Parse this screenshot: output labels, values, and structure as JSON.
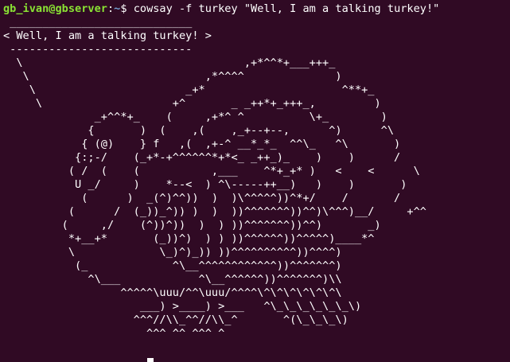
{
  "terminal": {
    "partial_line": "  ...",
    "prompt": {
      "user_host": "gb_ivan@gbserver",
      "separator": ":",
      "path": "~",
      "symbol": "$",
      "command": " cowsay -f turkey \"Well, I am a talking turkey!\""
    },
    "output_lines": [
      " ____________________________",
      "< Well, I am a talking turkey! >",
      " ----------------------------",
      "  \\                                  ,+*^^*+___+++_",
      "   \\                           ,*^^^^              )",
      "    \\                       _+*                     ^**+_",
      "     \\                    +^       _ _++*+_+++_,         )",
      "              _+^^*+_    (     ,+*^ ^          \\+_        )",
      "             {       )  (    ,(    ,_+--+--,      ^)      ^\\",
      "            { (@)    } f   ,(  ,+-^ __*_*_  ^^\\_   ^\\       )",
      "           {:;-/    (_+*-+^^^^^^*+*<_ _++_)_    )    )      /",
      "          ( /  (    (           ,___    ^*+_+* )   <    <      \\",
      "           U _/     )    *--<  ) ^\\-----++__)   )    )       )",
      "            (      )  _(^)^^))  )  )\\^^^^^))^*+/    /       /",
      "          (      /  (_))_^)) )  )  ))^^^^^^^))^^)\\^^^)__/     +^^",
      "         (     ,/    (^))^))  )  ) ))^^^^^^^))^^)       _)",
      "          *+__+*       (_))^)  ) ) ))^^^^^^))^^^^^)____*^",
      "          \\             \\_)^)_)) ))^^^^^^^^^^))^^^^)",
      "           (_             ^\\__^^^^^^^^^^^^))^^^^^^^)",
      "             ^\\___            ^\\__^^^^^^))^^^^^^^)\\\\",
      "                  ^^^^^\\uuu/^^\\uuu/^^^^\\^\\^\\^\\^\\^\\^\\",
      "                     ___) >____) >___   ^\\_\\_\\_\\_\\_\\_\\)",
      "                    ^^^//\\\\_^^//\\\\_^       ^(\\_\\_\\_\\)",
      "                      ^^^ ^^ ^^^ ^"
    ]
  }
}
